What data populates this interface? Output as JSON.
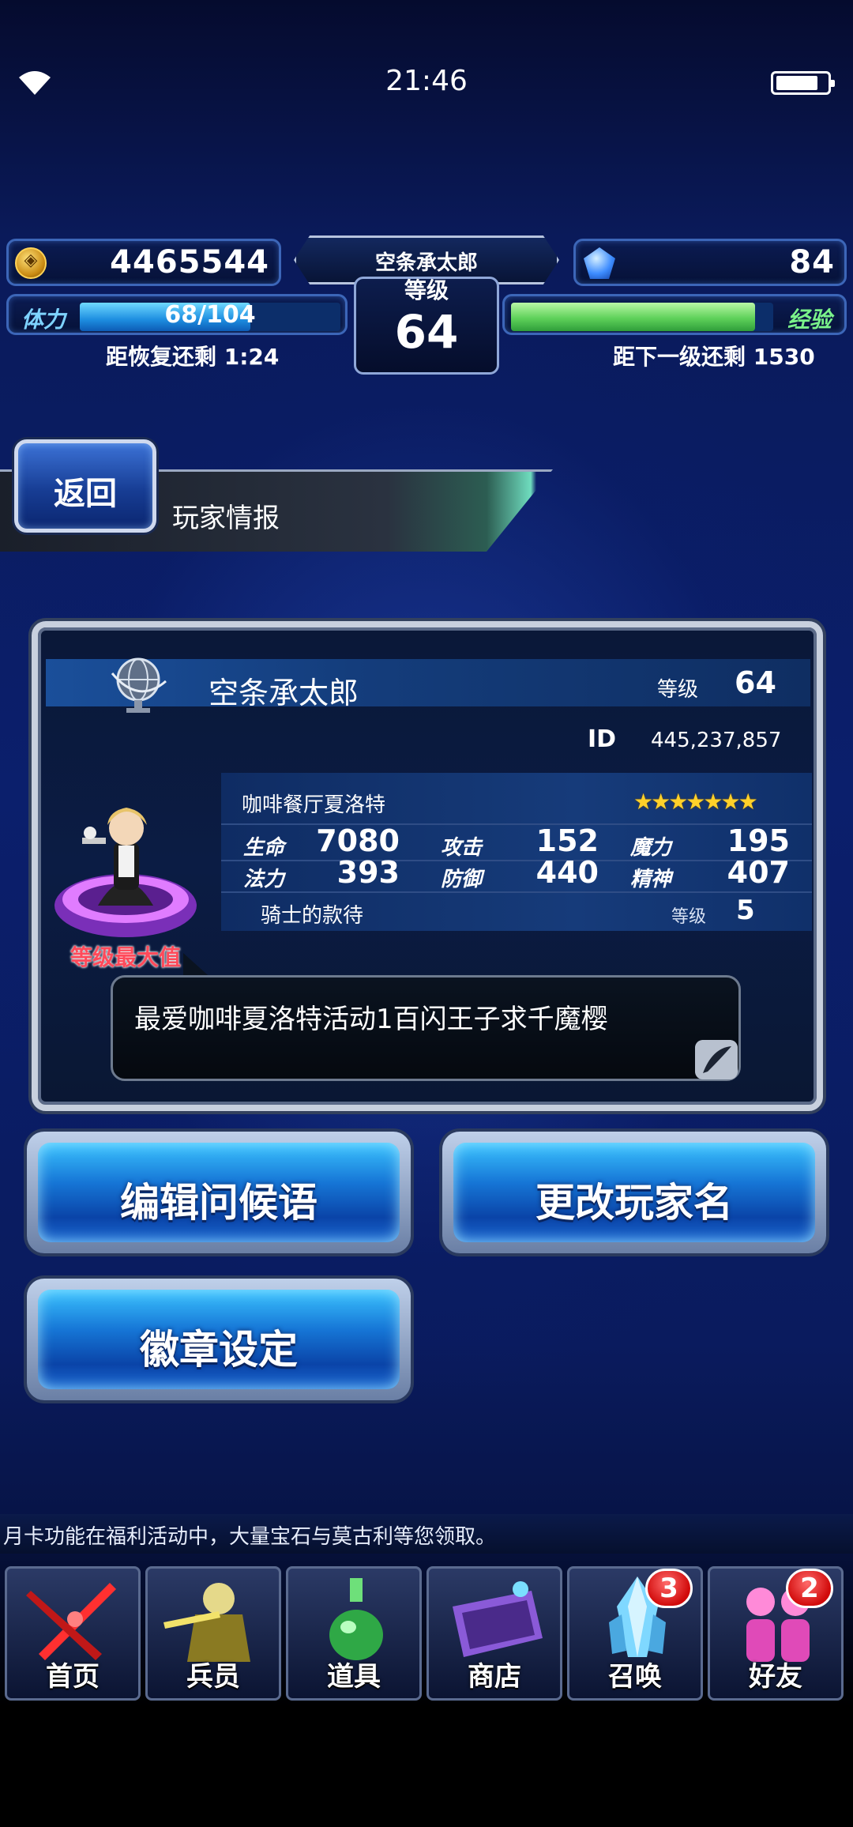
{
  "status_bar": {
    "time": "21:46"
  },
  "hud": {
    "gil": "4465544",
    "gems": "84",
    "player_name": "空条承太郎",
    "level_label": "等级",
    "level": "64",
    "stamina_label": "体力",
    "stamina_text": "68/104",
    "stamina_fraction": 0.654,
    "recover_text": "距恢复还剩 1:24",
    "exp_label": "经验",
    "exp_fraction": 0.93,
    "next_level_text": "距下一级还剩 1530"
  },
  "header": {
    "back_label": "返回",
    "title": "玩家情报"
  },
  "card": {
    "name": "空条承太郎",
    "level_label": "等级",
    "level": "64",
    "id_label": "ID",
    "id": "445,237,857",
    "unit_name": "咖啡餐厅夏洛特",
    "stars": "★★★★★★★",
    "stats": [
      {
        "label": "生命",
        "value": "7080"
      },
      {
        "label": "攻击",
        "value": "152"
      },
      {
        "label": "魔力",
        "value": "195"
      },
      {
        "label": "法力",
        "value": "393"
      },
      {
        "label": "防御",
        "value": "440"
      },
      {
        "label": "精神",
        "value": "407"
      }
    ],
    "skill_name": "骑士的款待",
    "skill_level_label": "等级",
    "skill_level": "5",
    "max_level_label": "等级最大值",
    "message": "最爱咖啡夏洛特活动1百闪王子求千魔樱"
  },
  "actions": {
    "edit_greeting": "编辑问候语",
    "change_name": "更改玩家名",
    "badge_setting": "徽章设定"
  },
  "ticker": "月卡功能在福利活动中，大量宝石与莫古利等您领取。",
  "nav": [
    {
      "label": "首页",
      "icon": "sword-icon",
      "badge": ""
    },
    {
      "label": "兵员",
      "icon": "hero-icon",
      "badge": ""
    },
    {
      "label": "道具",
      "icon": "potion-icon",
      "badge": ""
    },
    {
      "label": "商店",
      "icon": "shop-icon",
      "badge": ""
    },
    {
      "label": "召唤",
      "icon": "crystal-icon",
      "badge": "3"
    },
    {
      "label": "好友",
      "icon": "friends-icon",
      "badge": "2"
    }
  ],
  "colors": {
    "accent_blue": "#1676d6",
    "stamina": "#1d8de0",
    "exp": "#5fd15a",
    "badge_red": "#d10a0a",
    "stars": "#ffd12a"
  }
}
